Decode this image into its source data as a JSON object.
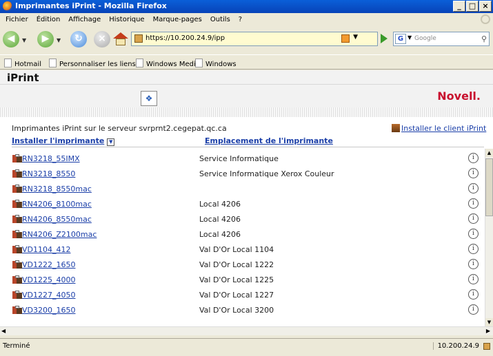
{
  "window": {
    "title": "Imprimantes iPrint - Mozilla Firefox",
    "buttons": [
      "_",
      "×"
    ]
  },
  "menu": [
    "Fichier",
    "Édition",
    "Affichage",
    "Historique",
    "Marque-pages",
    "Outils",
    "?"
  ],
  "navbar": {
    "url": "https://10.200.24.9/ipp",
    "search_placeholder": "Google"
  },
  "bookmarks": [
    "Hotmail",
    "Personnaliser les liens",
    "Windows Media",
    "Windows"
  ],
  "banner": {
    "title": "iPrint",
    "brand": "Novell."
  },
  "page": {
    "server_text": "Imprimantes iPrint sur le serveur svrprnt2.cegepat.qc.ca",
    "install_client": "Installer le client iPrint",
    "col_printer": "Installer l'imprimante",
    "col_location": "Emplacement de l'imprimante"
  },
  "printers": [
    {
      "name": "RN3218_55IMX",
      "location": "Service Informatique"
    },
    {
      "name": "RN3218_8550",
      "location": "Service Informatique Xerox Couleur"
    },
    {
      "name": "RN3218_8550mac",
      "location": ""
    },
    {
      "name": "RN4206_8100mac",
      "location": "Local 4206"
    },
    {
      "name": "RN4206_8550mac",
      "location": "Local 4206"
    },
    {
      "name": "RN4206_Z2100mac",
      "location": "Local 4206"
    },
    {
      "name": "VD1104_412",
      "location": "Val D'Or Local 1104"
    },
    {
      "name": "VD1222_1650",
      "location": "Val D'Or Local 1222"
    },
    {
      "name": "VD1225_4000",
      "location": "Val D'Or Local 1225"
    },
    {
      "name": "VD1227_4050",
      "location": "Val D'Or Local 1227"
    },
    {
      "name": "VD3200_1650",
      "location": "Val D'Or Local 3200"
    }
  ],
  "status": {
    "text": "Terminé",
    "host": "10.200.24.9"
  }
}
